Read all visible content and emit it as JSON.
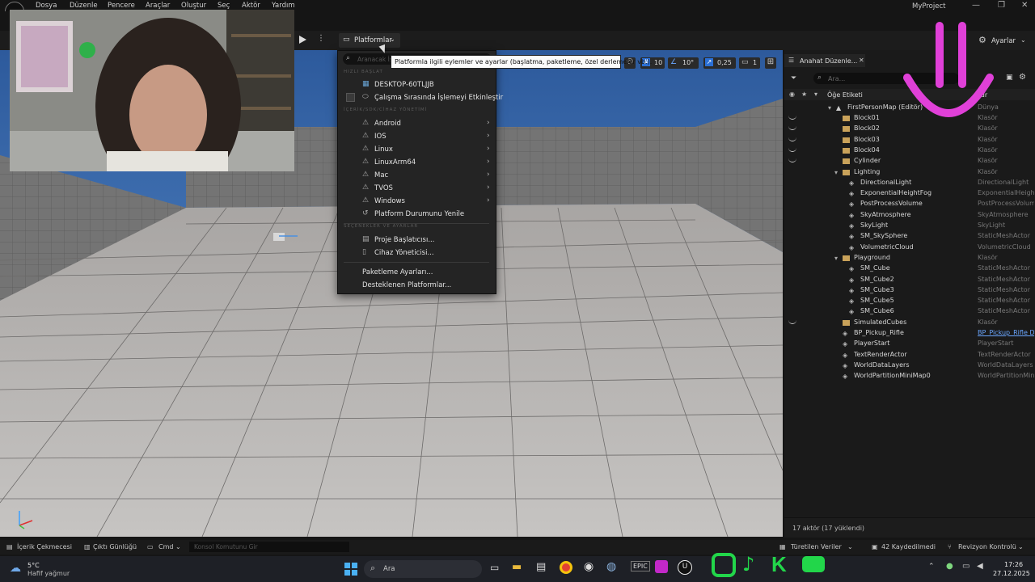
{
  "menu": {
    "items": [
      "Dosya",
      "Düzenle",
      "Pencere",
      "Araçlar",
      "Oluştur",
      "Seç",
      "Aktör",
      "Yardım"
    ],
    "project_name": "MyProject"
  },
  "toolbar": {
    "platforms_label": "Platformlar",
    "settings_label": "Ayarlar"
  },
  "viewport_controls": {
    "grid_snap": "10",
    "rotation_snap": "10°",
    "scale_snap": "0,25",
    "camera_speed": "1"
  },
  "dropdown": {
    "search_placeholder": "Aranacak İş",
    "tooltip": "Platformla ilgili eylemler ve ayarlar (başlatma, paketleme, özel derlemeler vb.).",
    "section_quick_launch": "HIZLI BAŞLAT",
    "device_name": "DESKTOP-60TLJJB",
    "enable_runtime_label": "Çalışma Sırasında İşlemeyi Etkinleştir",
    "section_sdk": "İÇERİK/SDK/CİHAZ YÖNETİMİ",
    "platforms": [
      "Android",
      "IOS",
      "Linux",
      "LinuxArm64",
      "Mac",
      "TVOS",
      "Windows"
    ],
    "refresh_label": "Platform Durumunu Yenile",
    "section_options": "SEÇENEKLER VE AYARLAR",
    "project_launcher": "Proje Başlatıcısı...",
    "device_manager": "Cihaz Yöneticisi...",
    "packaging_settings": "Paketleme Ayarları...",
    "supported_platforms": "Desteklenen Platformlar..."
  },
  "outliner": {
    "tab_label": "Anahat Düzenle...",
    "search_placeholder": "Ara...",
    "header_label": "Öğe Etiketi",
    "header_type": "Tür",
    "map_name": "FirstPersonMap (Editör)",
    "map_type": "Dünya",
    "rows": [
      {
        "name": "Block01",
        "type": "Klasör"
      },
      {
        "name": "Block02",
        "type": "Klasör"
      },
      {
        "name": "Block03",
        "type": "Klasör"
      },
      {
        "name": "Block04",
        "type": "Klasör"
      },
      {
        "name": "Cylinder",
        "type": "Klasör"
      },
      {
        "name": "Lighting",
        "type": "Klasör"
      },
      {
        "name": "DirectionalLight",
        "type": "DirectionalLight"
      },
      {
        "name": "ExponentialHeightFog",
        "type": "ExponentialHeightFog"
      },
      {
        "name": "PostProcessVolume",
        "type": "PostProcessVolume"
      },
      {
        "name": "SkyAtmosphere",
        "type": "SkyAtmosphere"
      },
      {
        "name": "SkyLight",
        "type": "SkyLight"
      },
      {
        "name": "SM_SkySphere",
        "type": "StaticMeshActor"
      },
      {
        "name": "VolumetricCloud",
        "type": "VolumetricCloud"
      },
      {
        "name": "Playground",
        "type": "Klasör"
      },
      {
        "name": "SM_Cube",
        "type": "StaticMeshActor"
      },
      {
        "name": "SM_Cube2",
        "type": "StaticMeshActor"
      },
      {
        "name": "SM_Cube3",
        "type": "StaticMeshActor"
      },
      {
        "name": "SM_Cube5",
        "type": "StaticMeshActor"
      },
      {
        "name": "SM_Cube6",
        "type": "StaticMeshActor"
      },
      {
        "name": "SimulatedCubes",
        "type": "Klasör"
      },
      {
        "name": "BP_Pickup_Rifle",
        "type": "BP_Pickup_Rifle D"
      },
      {
        "name": "PlayerStart",
        "type": "PlayerStart"
      },
      {
        "name": "TextRenderActor",
        "type": "TextRenderActor"
      },
      {
        "name": "WorldDataLayers",
        "type": "WorldDataLayers"
      },
      {
        "name": "WorldPartitionMiniMap0",
        "type": "WorldPartitionMin"
      }
    ],
    "footer": "17 aktör (17 yüklendi)"
  },
  "statusbar": {
    "content_drawer": "İçerik Çekmecesi",
    "output_log": "Çıktı Günlüğü",
    "cmd": "Cmd",
    "console_placeholder": "Konsol Komutunu Gir",
    "derived_data": "Türetilen Veriler",
    "unsaved": "42 Kaydedilmedi",
    "revision": "Revizyon Kontrolü"
  },
  "taskbar": {
    "temperature": "5°C",
    "weather": "Hafif yağmur",
    "search": "Ara",
    "time": "17:26",
    "date": "27.12.2025"
  },
  "colors": {
    "accent_blue": "#2a6fd6",
    "overlay_pink": "#e040d8",
    "sky_blue": "#3f6fb0"
  }
}
